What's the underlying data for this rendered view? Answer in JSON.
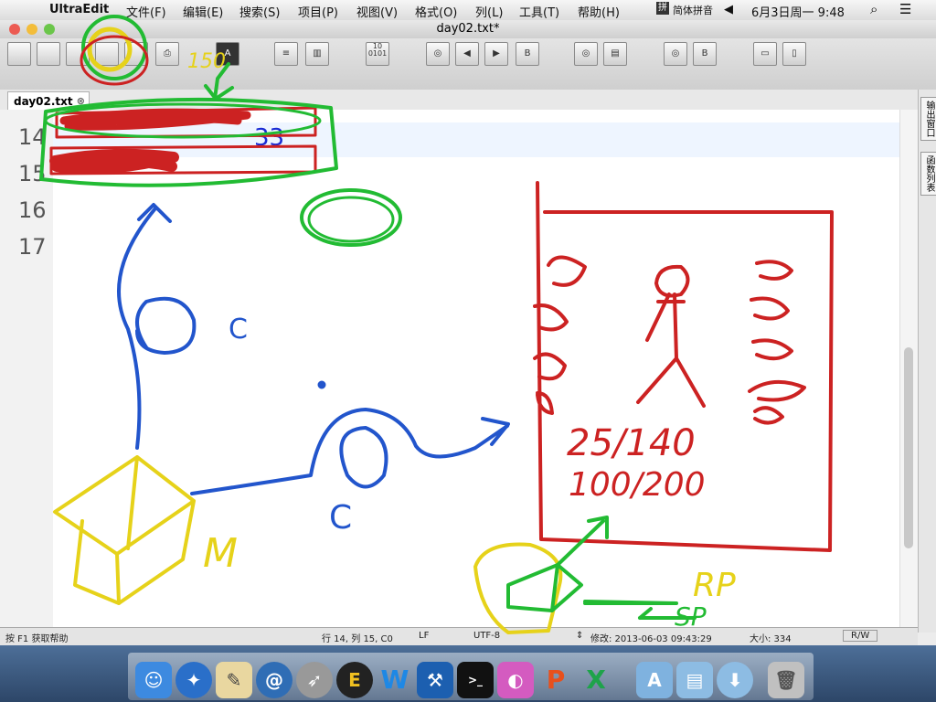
{
  "menubar": {
    "app_name": "UltraEdit",
    "items": [
      "文件(F)",
      "编辑(E)",
      "搜索(S)",
      "项目(P)",
      "视图(V)",
      "格式(O)",
      "列(L)",
      "工具(T)",
      "帮助(H)"
    ],
    "input_method": "简体拼音",
    "clock": "6月3日周一  9:48"
  },
  "window": {
    "title": "day02.txt*"
  },
  "tab": {
    "label": "day02.txt"
  },
  "editor": {
    "line_numbers": [
      "14",
      "15",
      "16",
      "17"
    ],
    "line14_text": "33"
  },
  "sidepanel": {
    "btn1": "输出窗口",
    "btn2": "函数列表"
  },
  "status": {
    "help": "按 F1 获取帮助",
    "position": "行 14, 列 15, C0",
    "line_ending": "LF",
    "encoding": "UTF-8",
    "modified": "修改: 2013-06-03 09:43:29",
    "size": "大小: 334",
    "mode": "R/W"
  },
  "annotations": {
    "fraction1": "25/140",
    "fraction2": "100/200",
    "letter_m": "M",
    "letter_c1": "C",
    "letter_c2": "C",
    "label_150": "150",
    "label_rp": "RP",
    "label_sp": "SP"
  },
  "colors": {
    "red": "#cc2222",
    "green": "#22bb33",
    "blue": "#2255cc",
    "yellow": "#e6d21a"
  },
  "dock": {
    "apps": [
      "finder",
      "safari",
      "textedit",
      "xcode-helper",
      "rocket",
      "ultraedit",
      "word",
      "xcode",
      "terminal",
      "pill",
      "powerpoint",
      "excel",
      "applications",
      "documents",
      "downloads",
      "trash"
    ]
  }
}
